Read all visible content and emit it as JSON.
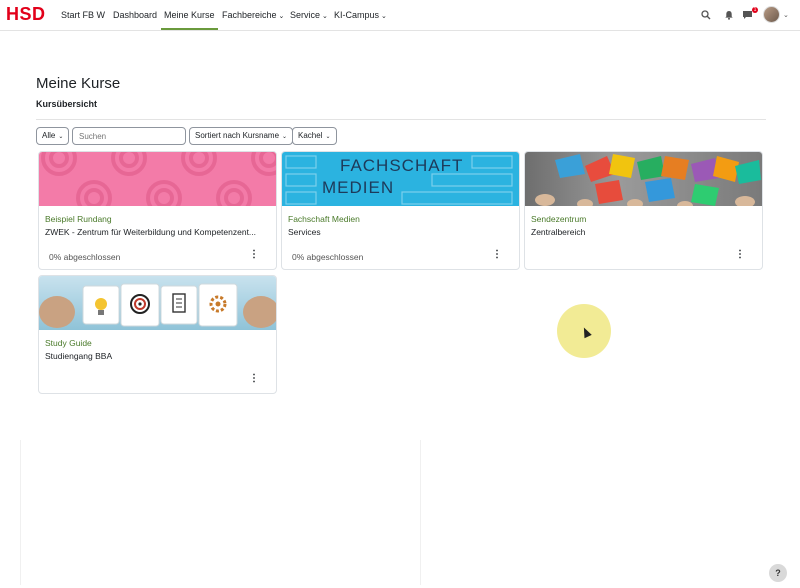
{
  "nav": {
    "logo": "HSD",
    "items": [
      {
        "label": "Start FB W",
        "dropdown": false
      },
      {
        "label": "Dashboard",
        "dropdown": false
      },
      {
        "label": "Meine Kurse",
        "dropdown": false,
        "active": true
      },
      {
        "label": "Fachbereiche",
        "dropdown": true
      },
      {
        "label": "Service",
        "dropdown": true
      },
      {
        "label": "KI-Campus",
        "dropdown": true
      }
    ],
    "caret": "⌄",
    "icons": [
      "search-icon",
      "bell-icon",
      "message-icon"
    ],
    "message_badge": "1"
  },
  "page": {
    "title": "Meine Kurse",
    "section_title": "Kursübersicht"
  },
  "filters": {
    "grouping": "Alle",
    "search_placeholder": "Suchen",
    "sort": "Sortiert nach Kursname",
    "view": "Kachel"
  },
  "courses": [
    {
      "category": "Beispiel Rundang",
      "title": "ZWEK - Zentrum für Weiterbildung und Kompetenzent...",
      "progress": "0% abgeschlossen",
      "image": "pink-circles"
    },
    {
      "category": "Fachschaft Medien",
      "title": "Services",
      "progress": "0% abgeschlossen",
      "image": "fachschaft-medien",
      "image_text_1": "FACHSCHAFT",
      "image_text_2": "MEDIEN"
    },
    {
      "category": "Sendezentrum",
      "title": "Zentralbereich",
      "progress": "",
      "image": "colorful-envelopes"
    },
    {
      "category": "Study Guide",
      "title": "Studiengang BBA",
      "progress": "",
      "image": "puzzle-pieces"
    }
  ],
  "menu_glyph": "⋮",
  "help": "?",
  "colors": {
    "brand": "#e2001a",
    "category": "#4a7a2a",
    "active_underline": "#6a9a3c"
  }
}
